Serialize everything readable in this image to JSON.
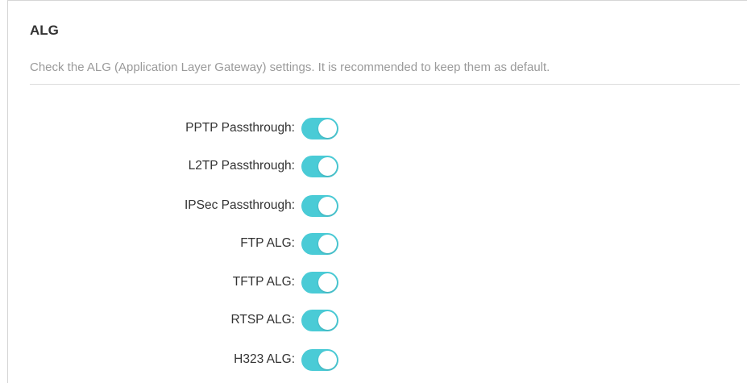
{
  "section": {
    "title": "ALG",
    "description": "Check the ALG (Application Layer Gateway) settings. It is recommended to keep them as default."
  },
  "colors": {
    "toggle_on": "#4acbd6",
    "text_primary": "#333333",
    "text_secondary": "#9a9a9a"
  },
  "settings": [
    {
      "id": "pptp",
      "label": "PPTP Passthrough:",
      "enabled": true
    },
    {
      "id": "l2tp",
      "label": "L2TP Passthrough:",
      "enabled": true
    },
    {
      "id": "ipsec",
      "label": "IPSec Passthrough:",
      "enabled": true
    },
    {
      "id": "ftp",
      "label": "FTP ALG:",
      "enabled": true
    },
    {
      "id": "tftp",
      "label": "TFTP ALG:",
      "enabled": true
    },
    {
      "id": "rtsp",
      "label": "RTSP ALG:",
      "enabled": true
    },
    {
      "id": "h323",
      "label": "H323 ALG:",
      "enabled": true
    }
  ]
}
